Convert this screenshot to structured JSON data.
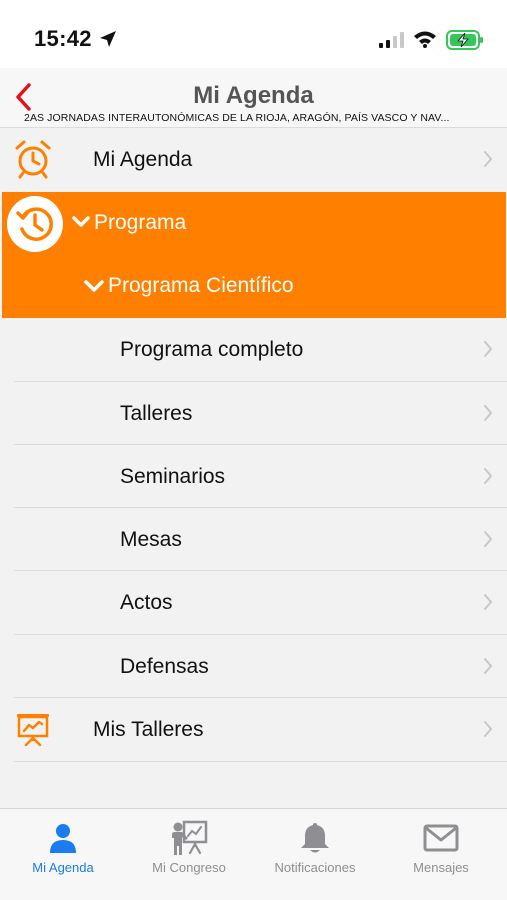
{
  "status_bar": {
    "time": "15:42"
  },
  "nav": {
    "title": "Mi Agenda",
    "subtitle": "2AS JORNADAS INTERAUTONÓMICAS DE LA RIOJA, ARAGÓN, PAÍS VASCO Y NAV..."
  },
  "menu": {
    "items": [
      {
        "label": "Mi Agenda",
        "icon": "alarm-clock-icon"
      },
      {
        "label": "Programa",
        "icon": "history-clock-icon",
        "expanded": true
      },
      {
        "label": "Programa Científico",
        "expanded": true
      },
      {
        "label": "Programa completo"
      },
      {
        "label": "Talleres"
      },
      {
        "label": "Seminarios"
      },
      {
        "label": "Mesas"
      },
      {
        "label": "Actos"
      },
      {
        "label": "Defensas"
      },
      {
        "label": "Mis Talleres",
        "icon": "presentation-board-icon"
      }
    ]
  },
  "tab_bar": {
    "tabs": [
      {
        "label": "Mi Agenda",
        "icon": "person-icon",
        "selected": true
      },
      {
        "label": "Mi Congreso",
        "icon": "presenter-icon"
      },
      {
        "label": "Notificaciones",
        "icon": "bell-icon"
      },
      {
        "label": "Mensajes",
        "icon": "envelope-icon"
      }
    ]
  },
  "colors": {
    "accent": "#ff8000",
    "back_arrow": "#e0121b",
    "tab_selected": "#1a7cf0",
    "tab_inactive": "#8e8e93",
    "battery": "#34c759"
  }
}
